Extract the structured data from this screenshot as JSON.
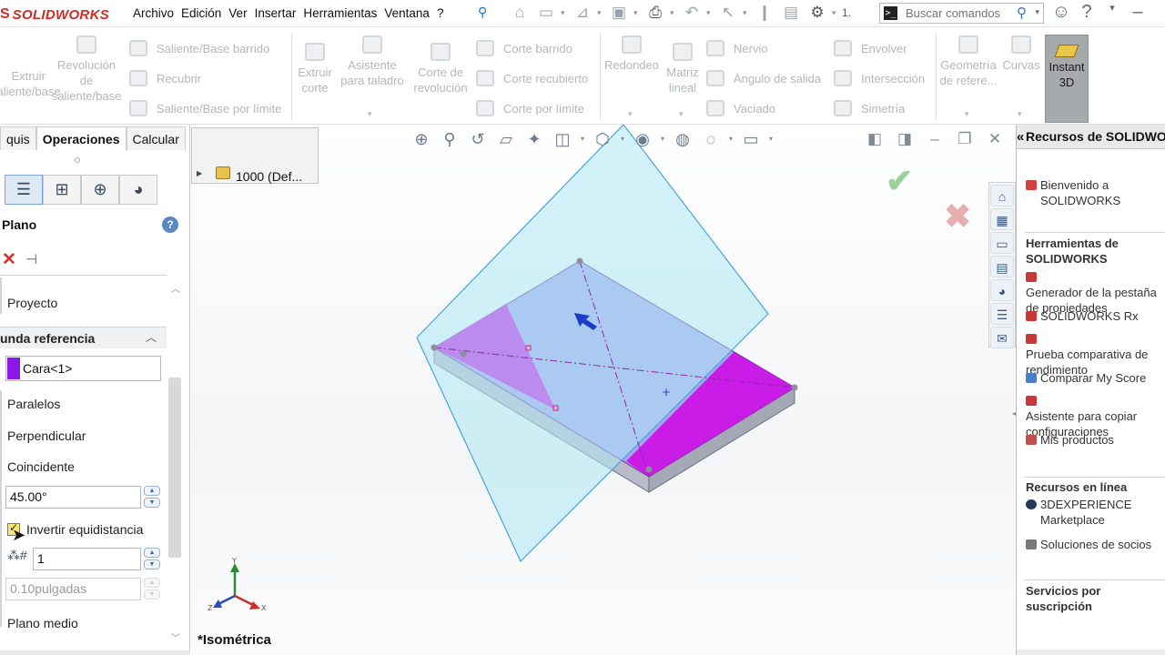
{
  "app": {
    "logo_mark": "S",
    "logo_text": "SOLIDWORKS",
    "menu": [
      "Archivo",
      "Edición",
      "Ver",
      "Insertar",
      "Herramientas",
      "Ventana",
      "?"
    ],
    "search_placeholder": "Buscar comandos",
    "toolbar_number": "1."
  },
  "command_manager": {
    "extrude_boss": "Extruir saliente/base",
    "revolve_boss": "Revolución de saliente/base",
    "swept_boss": "Saliente/Base barrido",
    "loft": "Recubrir",
    "boundary_boss": "Saliente/Base por límite",
    "extrude_cut": "Extruir corte",
    "hole_wizard": "Asistente para taladro",
    "revolve_cut": "Corte de revolución",
    "swept_cut": "Corte barrido",
    "lofted_cut": "Corte recubierto",
    "boundary_cut": "Corte por límite",
    "fillet": "Redondeo",
    "linear_pattern": "Matriz lineal",
    "rib": "Nervio",
    "draft": "Ángulo de salida",
    "shell": "Vaciado",
    "wrap": "Envolver",
    "intersect": "Intersección",
    "mirror": "Simetría",
    "ref_geometry": "Geometría de refere...",
    "curves": "Curvas",
    "instant3d": "Instant 3D"
  },
  "left_panel": {
    "tabs": [
      "quis",
      "Operaciones",
      "Calcular"
    ],
    "title": "Plano",
    "project_label": "Proyecto",
    "group_title": "unda referencia",
    "reference_value": "Cara<1>",
    "parallel_label": "Paralelos",
    "perpendicular_label": "Perpendicular",
    "coincident_label": "Coincidente",
    "angle_value": "45.00°",
    "flip_label": "Invertir equidistancia",
    "instances_value": "1",
    "distance_value": "0.10pulgadas",
    "mid_plane_label": "Plano medio"
  },
  "graphics": {
    "tree_item": "1000  (Def...",
    "view_name": "*Isométrica",
    "triad_x": "X",
    "triad_y": "Y",
    "triad_z": "Z"
  },
  "right_panel": {
    "title": "Recursos de SOLIDWORKS",
    "welcome": "Bienvenido a SOLIDWORKS",
    "tools_heading": "Herramientas de SOLIDWORKS",
    "tools": [
      "Generador de la pestaña de propiedades",
      "SOLIDWORKS Rx",
      "Prueba comparativa de rendimiento",
      "Comparar My Score",
      "Asistente para copiar configuraciones",
      "Mis productos"
    ],
    "online_heading": "Recursos en línea",
    "online": [
      "3DEXPERIENCE Marketplace",
      "Soluciones de socios"
    ],
    "subscription_heading": "Servicios por suscripción"
  },
  "colors": {
    "accent_red": "#d42a25",
    "face_magenta": "#cc11e6",
    "plane_cyan": "#aee8f4",
    "selection_swatch": "#8b18e6"
  }
}
